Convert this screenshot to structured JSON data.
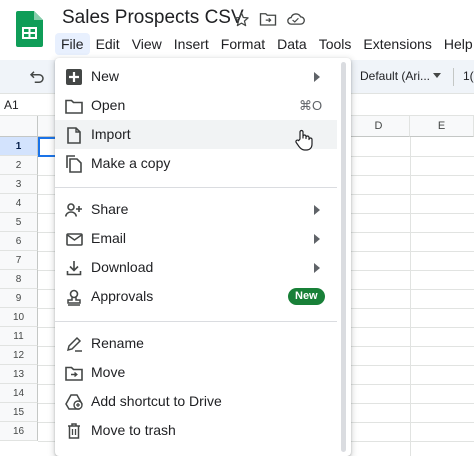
{
  "app": {
    "title": "Sales Prospects CSV",
    "logo_icon": "google-sheets-logo",
    "title_icons": [
      "star-icon",
      "move-folder-icon",
      "cloud-status-icon"
    ]
  },
  "menubar": [
    "File",
    "Edit",
    "View",
    "Insert",
    "Format",
    "Data",
    "Tools",
    "Extensions",
    "Help"
  ],
  "menubar_active": "File",
  "toolbar": {
    "undo_icon": "undo-icon",
    "font_select": "Default (Ari...",
    "font_size_partial": "1("
  },
  "formula_bar": {
    "name_box": "A1"
  },
  "grid": {
    "columns": [
      "D",
      "E"
    ],
    "rows": [
      "1",
      "2",
      "3",
      "4",
      "5",
      "6",
      "7",
      "8",
      "9",
      "10",
      "11",
      "12",
      "13",
      "14",
      "15",
      "16"
    ],
    "selected_cell": "A1"
  },
  "file_menu": {
    "groups": [
      [
        {
          "label": "New",
          "icon": "new-sheet-icon",
          "submenu": true
        },
        {
          "label": "Open",
          "icon": "folder-open-icon",
          "shortcut": "⌘O"
        },
        {
          "label": "Import",
          "icon": "import-file-icon",
          "hovered": true
        },
        {
          "label": "Make a copy",
          "icon": "copy-icon"
        }
      ],
      [
        {
          "label": "Share",
          "icon": "share-person-icon",
          "submenu": true
        },
        {
          "label": "Email",
          "icon": "email-icon",
          "submenu": true
        },
        {
          "label": "Download",
          "icon": "download-icon",
          "submenu": true
        },
        {
          "label": "Approvals",
          "icon": "approvals-icon",
          "badge": "New"
        }
      ],
      [
        {
          "label": "Rename",
          "icon": "rename-pencil-icon"
        },
        {
          "label": "Move",
          "icon": "move-folder-icon"
        },
        {
          "label": "Add shortcut to Drive",
          "icon": "drive-shortcut-icon"
        },
        {
          "label": "Move to trash",
          "icon": "trash-icon"
        }
      ]
    ]
  },
  "colors": {
    "sheets_green": "#0f9d58",
    "badge_green": "#188038",
    "selection_blue": "#1a73e8",
    "menu_active_bg": "#e8f0fe"
  }
}
